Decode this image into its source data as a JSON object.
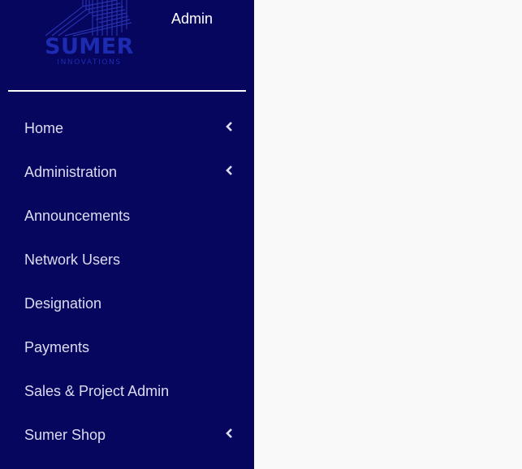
{
  "brand": {
    "name": "SUMER",
    "tagline": "INNOVATIONS",
    "color": "#1d2bb0"
  },
  "user": {
    "role_label": "Admin"
  },
  "theme": {
    "sidebar_bg": "#07065e",
    "content_bg": "#f9f9f9",
    "menu_text": "#dcdcf0",
    "divider": "#ffffff"
  },
  "menu": {
    "items": [
      {
        "label": "Home",
        "icon": "chevron-left-icon",
        "has_submenu": true
      },
      {
        "label": "Administration",
        "icon": "chevron-left-icon",
        "has_submenu": true
      },
      {
        "label": "Announcements",
        "has_submenu": false
      },
      {
        "label": "Network Users",
        "has_submenu": false
      },
      {
        "label": "Designation",
        "has_submenu": false
      },
      {
        "label": "Payments",
        "has_submenu": false
      },
      {
        "label": "Sales & Project Admin",
        "has_submenu": false
      },
      {
        "label": "Sumer Shop",
        "icon": "chevron-left-icon",
        "has_submenu": true
      }
    ]
  }
}
